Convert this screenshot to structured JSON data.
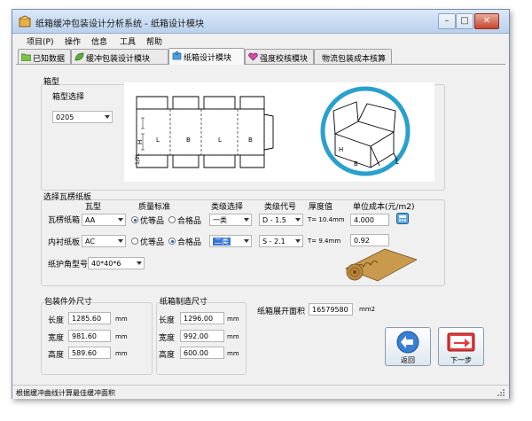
{
  "window": {
    "title": "纸箱缓冲包装设计分析系统 - 纸箱设计模块",
    "minimize": "–",
    "maximize": "□",
    "close": "✕"
  },
  "menu": [
    "项目(P)",
    "操作",
    "信息",
    "工具",
    "帮助"
  ],
  "tabs": [
    "已知数据",
    "缓冲包装设计模块",
    "纸箱设计模块",
    "强度校核模块",
    "物流包装成本核算"
  ],
  "box_type": {
    "group_label": "箱型",
    "select_label": "箱型选择",
    "selected": "0205",
    "flat_labels": {
      "h": "H",
      "sub": "1/2L",
      "l1": "L",
      "b1": "B",
      "l2": "L",
      "b2": "B"
    },
    "box3d_labels": {
      "h": "H",
      "b": "B",
      "l": "L"
    }
  },
  "flute": {
    "group_label": "选择瓦楞纸板",
    "headers": {
      "flute": "瓦型",
      "quality": "质量标准",
      "category": "类级选择",
      "grade": "类级代号",
      "thickness": "厚度值",
      "cost": "单位成本(元/m2)"
    },
    "rows": [
      {
        "label": "瓦楞纸箱",
        "flute": "AA",
        "q1": "优等品",
        "q2": "合格品",
        "q_selected": 1,
        "category": "一类",
        "grade": "D - 1.5",
        "thickness": "T= 10.4mm",
        "cost": "4.000"
      },
      {
        "label": "内衬纸板",
        "flute": "AC",
        "q1": "优等品",
        "q2": "合格品",
        "q_selected": 2,
        "category": "二类",
        "grade": "S - 2.1",
        "thickness": "T= 9.4mm",
        "cost": "0.92"
      }
    ],
    "corner_label": "纸护角型号",
    "corner_value": "40*40*6"
  },
  "outer_size": {
    "group_label": "包装件外尺寸",
    "rows": [
      {
        "label": "长度",
        "value": "1285.60",
        "unit": "mm"
      },
      {
        "label": "宽度",
        "value": "981.60",
        "unit": "mm"
      },
      {
        "label": "高度",
        "value": "589.60",
        "unit": "mm"
      }
    ]
  },
  "make_size": {
    "group_label": "纸箱制造尺寸",
    "rows": [
      {
        "label": "长度",
        "value": "1296.00",
        "unit": "mm"
      },
      {
        "label": "宽度",
        "value": "992.00",
        "unit": "mm"
      },
      {
        "label": "高度",
        "value": "600.00",
        "unit": "mm"
      }
    ]
  },
  "area": {
    "label": "纸箱展开面积",
    "value": "16579580",
    "unit": "mm2"
  },
  "buttons": {
    "back": "返回",
    "next": "下一步"
  },
  "status": "根据缓冲曲线计算最佳缓冲面积"
}
